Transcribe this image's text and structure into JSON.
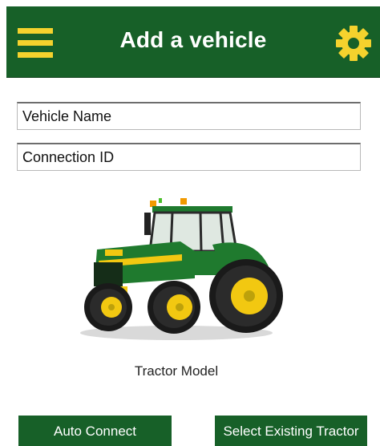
{
  "header": {
    "title": "Add a vehicle",
    "menu_icon": "hamburger-menu-icon",
    "settings_icon": "gear-icon"
  },
  "form": {
    "vehicle_name_value": "Vehicle Name",
    "connection_id_value": "Connection ID"
  },
  "tractor": {
    "caption": "Tractor Model"
  },
  "actions": {
    "auto_connect_label": "Auto Connect",
    "select_existing_label": "Select Existing Tractor"
  },
  "colors": {
    "brand_green": "#176028",
    "accent_yellow": "#f5d22d",
    "tractor_green": "#1f7a2e",
    "tractor_yellow": "#f2c811"
  }
}
